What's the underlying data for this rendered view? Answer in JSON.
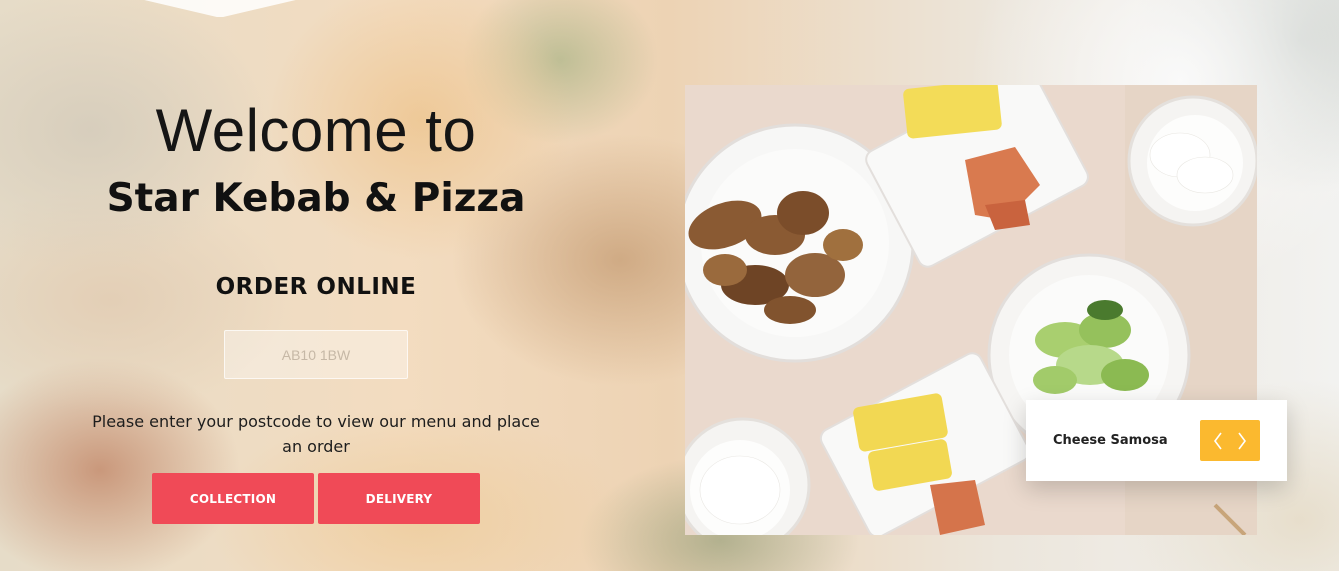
{
  "hero": {
    "welcome": "Welcome to",
    "restaurant_name": "Star Kebab & Pizza",
    "order_online": "ORDER ONLINE",
    "postcode_placeholder": "AB10 1BW",
    "instructions": "Please enter your postcode to view our menu and place an order"
  },
  "buttons": {
    "collection": "COLLECTION",
    "delivery": "DELIVERY"
  },
  "slider": {
    "caption": "Cheese Samosa",
    "prev_icon": "chevron-left-icon",
    "next_icon": "chevron-right-icon"
  },
  "colors": {
    "button_red": "#f04a57",
    "slider_yellow": "#fbb92f"
  }
}
